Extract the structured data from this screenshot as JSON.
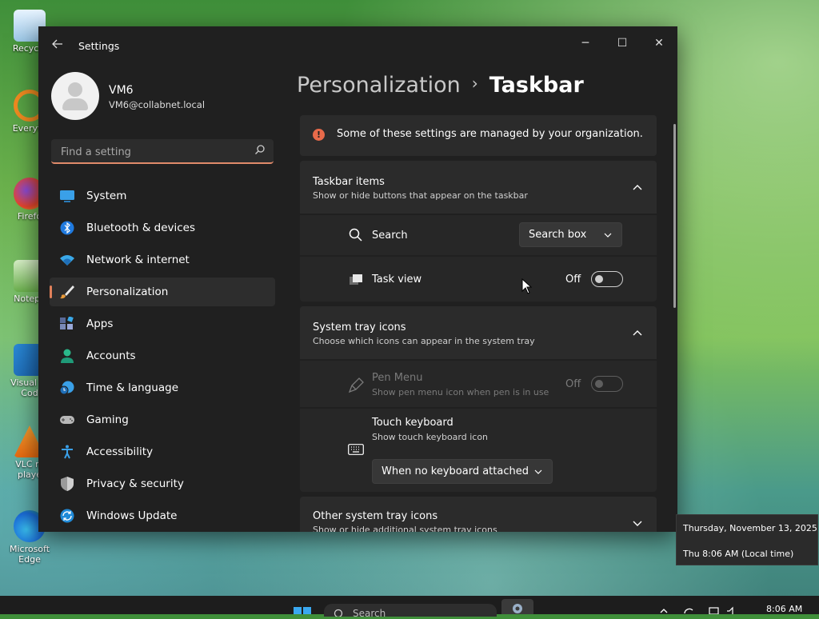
{
  "desktop": {
    "icons": [
      {
        "label": "Recycle",
        "name": "recycle-bin-icon"
      },
      {
        "label": "Everyth",
        "name": "everything-search-icon"
      },
      {
        "label": "Firefo",
        "name": "firefox-icon"
      },
      {
        "label": "Notepa",
        "name": "notepad-icon"
      },
      {
        "label": "Visual St\nCod",
        "name": "vscode-icon"
      },
      {
        "label": "VLC m\nplaye",
        "name": "vlc-icon"
      },
      {
        "label": "Microsoft\nEdge",
        "name": "edge-icon"
      }
    ]
  },
  "window": {
    "app_title": "Settings",
    "controls": {
      "minimize": "─",
      "maximize": "☐",
      "close": "✕"
    }
  },
  "profile": {
    "name": "VM6",
    "email": "VM6@collabnet.local"
  },
  "search": {
    "placeholder": "Find a setting"
  },
  "sidebar": {
    "items": [
      {
        "label": "System",
        "icon": "monitor-icon",
        "active": false
      },
      {
        "label": "Bluetooth & devices",
        "icon": "bluetooth-icon",
        "active": false
      },
      {
        "label": "Network & internet",
        "icon": "wifi-icon",
        "active": false
      },
      {
        "label": "Personalization",
        "icon": "brush-icon",
        "active": true
      },
      {
        "label": "Apps",
        "icon": "apps-icon",
        "active": false
      },
      {
        "label": "Accounts",
        "icon": "person-icon",
        "active": false
      },
      {
        "label": "Time & language",
        "icon": "globe-clock-icon",
        "active": false
      },
      {
        "label": "Gaming",
        "icon": "gamepad-icon",
        "active": false
      },
      {
        "label": "Accessibility",
        "icon": "accessibility-icon",
        "active": false
      },
      {
        "label": "Privacy & security",
        "icon": "shield-icon",
        "active": false
      },
      {
        "label": "Windows Update",
        "icon": "update-icon",
        "active": false
      }
    ]
  },
  "breadcrumb": {
    "parent": "Personalization",
    "separator": "›",
    "current": "Taskbar"
  },
  "notice": {
    "icon": "!",
    "text": "Some of these settings are managed by your organization."
  },
  "taskbar_items": {
    "title": "Taskbar items",
    "description": "Show or hide buttons that appear on the taskbar",
    "rows": {
      "search": {
        "label": "Search",
        "value": "Search box"
      },
      "task_view": {
        "label": "Task view",
        "state": "Off"
      }
    }
  },
  "system_tray_icons": {
    "title": "System tray icons",
    "description": "Choose which icons can appear in the system tray",
    "rows": {
      "pen_menu": {
        "label": "Pen Menu",
        "description": "Show pen menu icon when pen is in use",
        "state": "Off"
      },
      "touch_keyboard": {
        "label": "Touch keyboard",
        "description": "Show touch keyboard icon",
        "value": "When no keyboard attached"
      }
    }
  },
  "other_tray_icons": {
    "title": "Other system tray icons",
    "description": "Show or hide additional system tray icons"
  },
  "clock_flyout": {
    "date": "Thursday, November 13, 2025",
    "time": "Thu 8:06 AM (Local time)"
  },
  "taskbar": {
    "search_placeholder": "Search",
    "time": "8:06 AM"
  },
  "colors": {
    "accent": "#e0805a",
    "window_bg": "#202020",
    "card_bg": "#2b2b2b",
    "notice_icon": "#e86a4a"
  }
}
